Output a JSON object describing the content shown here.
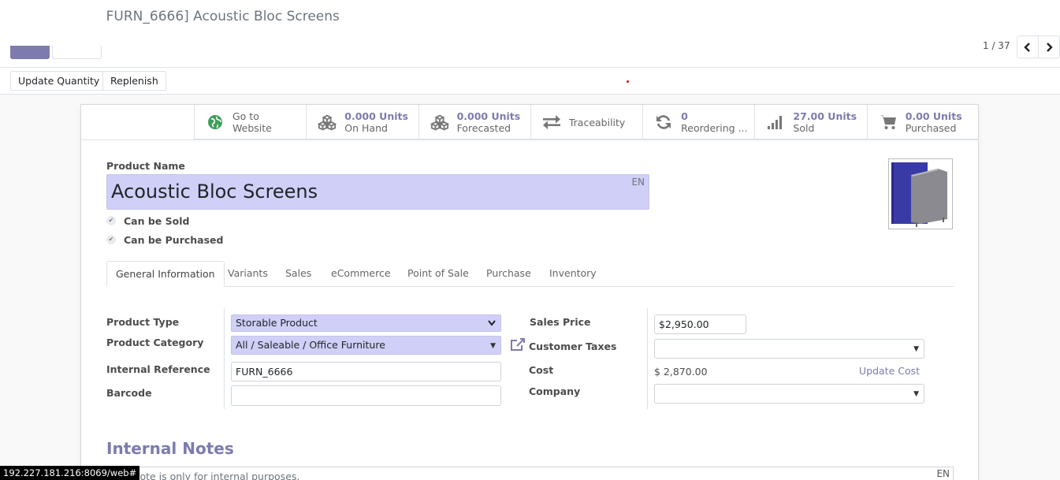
{
  "breadcrumb": {
    "title": "[FURN_6666] Acoustic Bloc Screens"
  },
  "pager": {
    "value": "1 / 37"
  },
  "status_buttons": [
    {
      "value": "",
      "label": "Update Quantity"
    },
    {
      "value": "",
      "label": "Replenish"
    }
  ],
  "smart_buttons": [
    {
      "icon": "globe-icon",
      "value": "Go to",
      "label": "Website"
    },
    {
      "icon": "cubes-icon",
      "value": "0.000 Units",
      "label": "On Hand"
    },
    {
      "icon": "cubes-icon",
      "value": "0.000 Units",
      "label": "Forecasted"
    },
    {
      "icon": "exchange-icon",
      "value": "",
      "label": "Traceability"
    },
    {
      "icon": "refresh-icon",
      "value": "0",
      "label": "Reordering ..."
    },
    {
      "icon": "signal-icon",
      "value": "27.00 Units",
      "label": "Sold"
    },
    {
      "icon": "cart-icon",
      "value": "0.00 Units",
      "label": "Purchased"
    }
  ],
  "form": {
    "name_label": "Product Name",
    "name_value": "Acoustic Bloc Screens",
    "lang": "EN",
    "can_be_sold": "Can be Sold",
    "can_be_purchased": "Can be Purchased"
  },
  "tabs": [
    "General Information",
    "Variants",
    "Sales",
    "eCommerce",
    "Point of Sale",
    "Purchase",
    "Inventory"
  ],
  "general": {
    "product_type_label": "Product Type",
    "product_type_value": "Storable Product",
    "product_category_label": "Product Category",
    "product_category_value": "All / Saleable / Office Furniture",
    "internal_ref_label": "Internal Reference",
    "internal_ref_value": "FURN_6666",
    "barcode_label": "Barcode",
    "barcode_value": "",
    "sales_price_label": "Sales Price",
    "sales_price_value": "$2,950.00",
    "customer_taxes_label": "Customer Taxes",
    "customer_taxes_value": "",
    "cost_label": "Cost",
    "cost_value": "$ 2,870.00",
    "update_cost": "Update Cost",
    "company_label": "Company",
    "company_value": ""
  },
  "notes": {
    "title": "Internal Notes",
    "placeholder": "This note is only for internal purposes.",
    "lang": "EN"
  },
  "statusbar": {
    "url": "192.227.181.216:8069/web#"
  },
  "colors": {
    "accent": "#7c7bad",
    "field_bg": "#cfcff7",
    "globe": "#3f9f5a"
  }
}
